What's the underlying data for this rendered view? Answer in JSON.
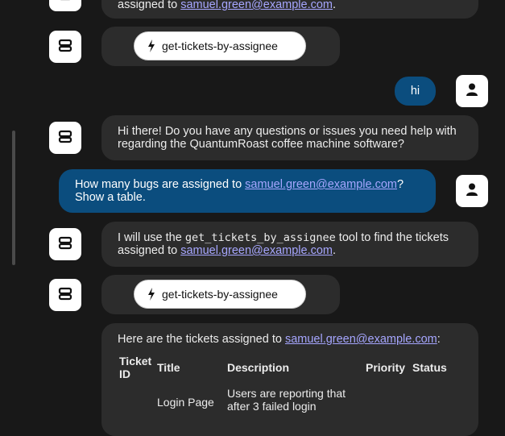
{
  "colors": {
    "background": "#181818",
    "bot_bubble": "#2c2c2c",
    "user_bubble": "#0b4d7e",
    "link": "#a6a6ff"
  },
  "icons": {
    "bot": "robot-icon",
    "user": "person-icon",
    "tool": "lightning-bolt-icon"
  },
  "messages": {
    "m0_prefix": "assigned to ",
    "m0_link": "samuel.green@example.com",
    "m0_suffix": ".",
    "m1_tool": "get-tickets-by-assignee",
    "m2_text": "hi",
    "m3_text": "Hi there! Do you have any questions or issues you need help with regarding the QuantumRoast coffee machine software?",
    "m4_prefix": "How many bugs are assigned to ",
    "m4_link": "samuel.green@example.com",
    "m4_suffix": "? Show a table.",
    "m5_prefix": "I will use the ",
    "m5_code": "get_tickets_by_assignee",
    "m5_middle": " tool to find the tickets assigned to ",
    "m5_link": "samuel.green@example.com",
    "m5_suffix": ".",
    "m6_tool": "get-tickets-by-assignee",
    "m7_prefix": "Here are the tickets assigned to ",
    "m7_link": "samuel.green@example.com",
    "m7_suffix": ":"
  },
  "table": {
    "headers": [
      "Ticket ID",
      "Title",
      "Description",
      "Priority",
      "Status"
    ],
    "row1": {
      "title": "Login Page",
      "description": "Users are reporting that after 3 failed login"
    }
  }
}
